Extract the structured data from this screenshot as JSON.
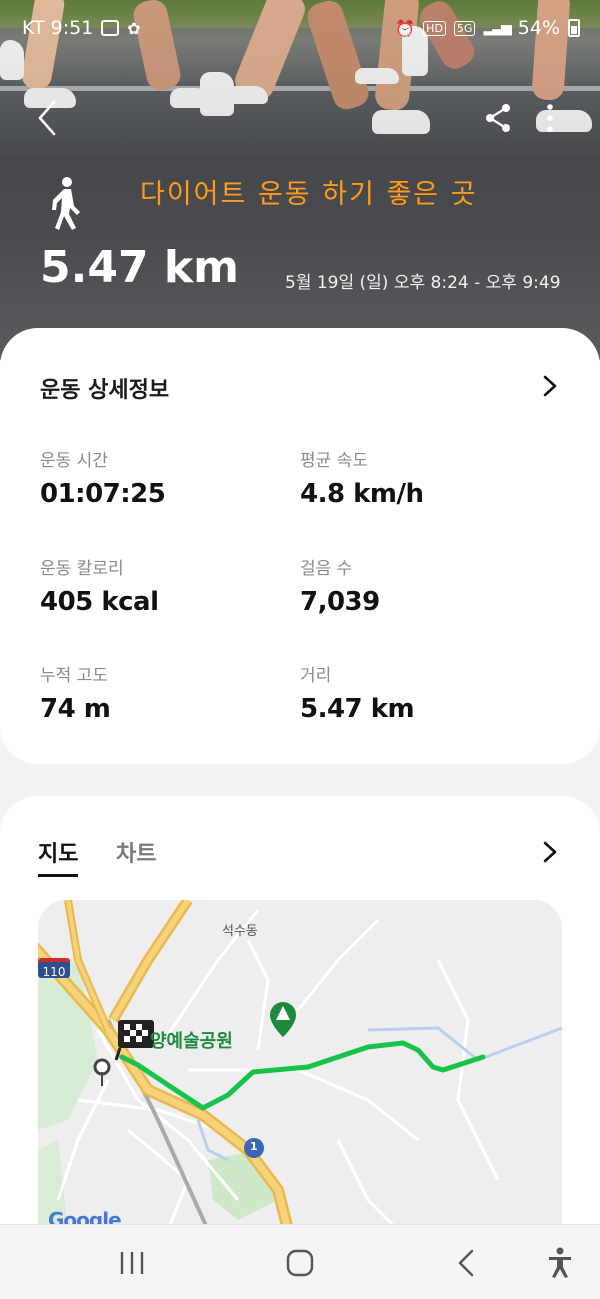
{
  "status_bar": {
    "carrier_time": "KT 9:51",
    "network": "5G",
    "battery": "54%"
  },
  "header": {
    "title": "다이어트 운동 하기 좋은 곳",
    "distance": "5.47 km",
    "time_range": "5월 19일 (일) 오후 8:24 - 오후 9:49",
    "activity_icon": "walking-person-icon"
  },
  "details": {
    "title": "운동 상세정보",
    "metrics": [
      {
        "label": "운동 시간",
        "value": "01:07:25"
      },
      {
        "label": "평균 속도",
        "value": "4.8 km/h"
      },
      {
        "label": "운동 칼로리",
        "value": "405 kcal"
      },
      {
        "label": "걸음 수",
        "value": "7,039"
      },
      {
        "label": "누적 고도",
        "value": "74 m"
      },
      {
        "label": "거리",
        "value": "5.47 km"
      }
    ]
  },
  "map_section": {
    "tabs": [
      "지도",
      "차트"
    ],
    "active_tab": "지도",
    "map_labels": {
      "district": "석수동",
      "park": "양예술공원",
      "highway": "110",
      "route_number": "1",
      "attribution": "Google"
    },
    "route_color": "#19c34a"
  },
  "colors": {
    "title_accent": "#ff9b1a",
    "card_bg": "#ffffff",
    "page_bg": "#f3f3f5"
  }
}
